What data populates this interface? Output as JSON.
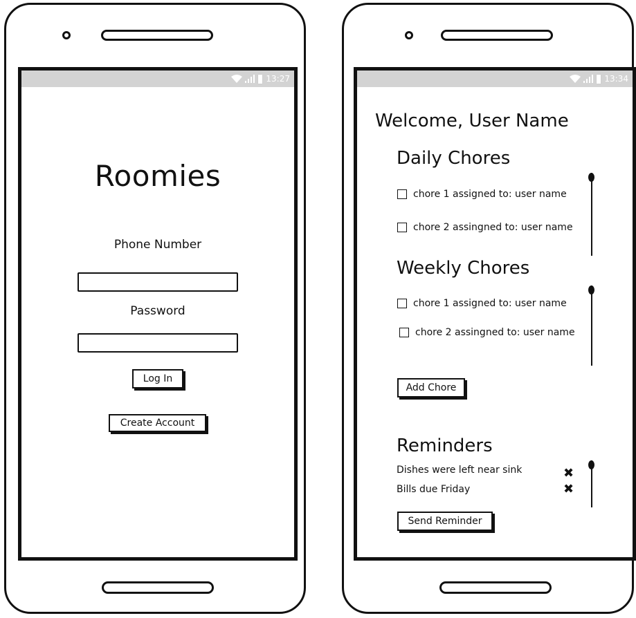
{
  "login": {
    "status_time": "13:27",
    "app_title": "Roomies",
    "phone_label": "Phone Number",
    "password_label": "Password",
    "login_button": "Log In",
    "create_account_button": "Create Account"
  },
  "home": {
    "status_time": "13:34",
    "welcome": "Welcome, User Name",
    "daily_title": "Daily Chores",
    "daily_chores": [
      "chore 1 assigned to: user name",
      "chore 2 assingned to: user name"
    ],
    "weekly_title": "Weekly Chores",
    "weekly_chores": [
      "chore 1 assigned to: user name",
      "chore 2 assingned to: user name"
    ],
    "add_chore_button": "Add Chore",
    "reminders_title": "Reminders",
    "reminders": [
      "Dishes were left near sink",
      "Bills due Friday"
    ],
    "send_reminder_button": "Send Reminder"
  },
  "icons": {
    "status": [
      "wifi-icon",
      "signal-icon",
      "battery-icon"
    ],
    "delete": "close-icon",
    "checkbox": "checkbox-icon"
  },
  "colors": {
    "statusbar": "#d3d3d3",
    "ink": "#111111"
  }
}
